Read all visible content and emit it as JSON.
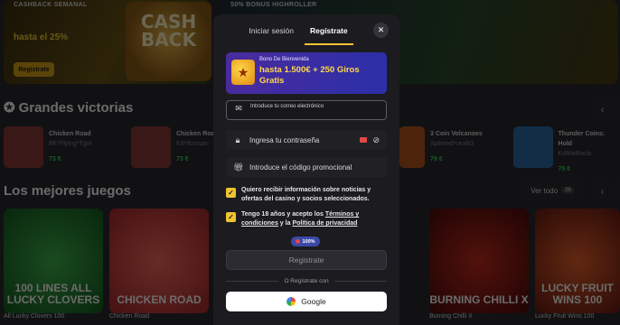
{
  "background": {
    "promos": [
      {
        "tag": "CASHBACK SEMANAL",
        "headline": "hasta el 25%",
        "button": "Registrate",
        "art": "CASH BACK"
      },
      {
        "tag": "50% BONUS HIGHROLLER"
      }
    ],
    "grandes_victorias": {
      "title": "Grandes victorias",
      "items": [
        {
          "name": "Chicken Road",
          "user": "BE*Flying*Tgm",
          "amount": "73 €",
          "thumb_color": "#8a3a3a"
        },
        {
          "name": "Chicken Road",
          "user": "K8*ifcorsan",
          "amount": "73 €",
          "thumb_color": "#8a3a3a"
        },
        {
          "name": "3 Coin Volcanoes",
          "user": "Splinted*ceaN3",
          "amount": "79 €",
          "thumb_color": "#b4561a"
        },
        {
          "name": "Thunder Coins: Hold",
          "user": "Ki#klaBocla",
          "amount": "75 €",
          "thumb_color": "#2e6aa8"
        }
      ]
    },
    "mejores_juegos": {
      "title": "Los mejores juegos",
      "ver_todo": "Ver todo",
      "count": "26",
      "games": [
        {
          "name": "All Lucky Clovers 100",
          "art": "100 LINES ALL LUCKY CLOVERS",
          "color": "#1f7a2a"
        },
        {
          "name": "Chicken Road",
          "art": "CHICKEN ROAD",
          "color": "#c43b3b"
        },
        {
          "name": "Burning Chilli X",
          "art": "BURNING CHILLI X",
          "color": "#8a1a1a"
        },
        {
          "name": "Lucky Fruit Wins 100",
          "art": "LUCKY FRUIT WINS 100",
          "color": "#b43a1a"
        }
      ]
    }
  },
  "modal": {
    "tabs": [
      {
        "label": "Iniciar sesión",
        "active": false
      },
      {
        "label": "Regístrate",
        "active": true
      }
    ],
    "bonus": {
      "small": "Bono De Bienvenida",
      "big": "hasta 1.500€ + 250 Giros Gratis"
    },
    "email_placeholder": "Introduce tu correo electrónico",
    "password_placeholder": "Ingresa tu contraseña",
    "promo_placeholder": "Introduce el código promocional",
    "consent_marketing": "Quiero recibir información sobre noticias y ofertas del casino y socios seleccionados.",
    "consent_terms": {
      "prefix": "Tengo 18 años y acepto los",
      "terms_link": "Términos y condiciones",
      "middle": "y la",
      "privacy_link": "Política de privacidad"
    },
    "strength": "100%",
    "submit": "Registrate",
    "divider": "O Regístrate con",
    "google": "Google"
  }
}
